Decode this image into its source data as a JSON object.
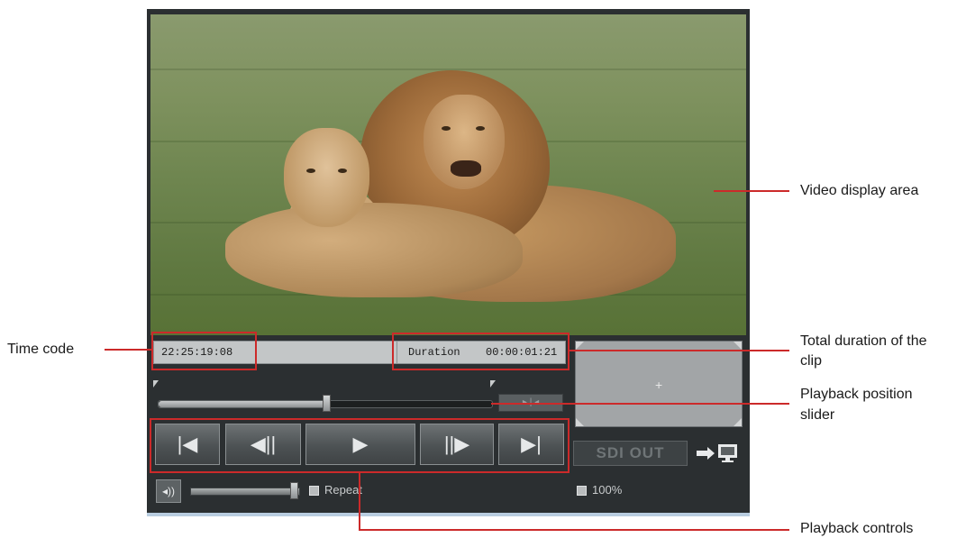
{
  "video": {
    "description_icon": "lion-pair-video-frame"
  },
  "display": {
    "timecode": "22:25:19:08",
    "duration_label": "Duration",
    "duration_value": "00:00:01:21",
    "preview_plus": "+"
  },
  "slider": {
    "position_fraction": 0.51
  },
  "controls": [
    {
      "name": "skip-to-start",
      "glyph": "|◀"
    },
    {
      "name": "previous-frame",
      "glyph": "◀||"
    },
    {
      "name": "play",
      "glyph": "▶"
    },
    {
      "name": "next-frame",
      "glyph": "||▶"
    },
    {
      "name": "skip-to-end",
      "glyph": "▶|"
    }
  ],
  "sdi_out": {
    "label": "SDI OUT",
    "icon": "arrow-to-monitor-icon"
  },
  "volume": {
    "icon": "speaker-icon",
    "level_fraction": 0.95
  },
  "repeat": {
    "label": "Repeat"
  },
  "zoom": {
    "label": "100%"
  },
  "annotations": {
    "time_code": "Time code",
    "video_display_area": "Video display area",
    "total_duration_line1": "Total duration of the",
    "total_duration_line2": "clip",
    "slider_line1": "Playback position",
    "slider_line2": "slider",
    "playback_controls": "Playback controls"
  },
  "colors": {
    "annotation_red": "#cc2a2a",
    "player_bg": "#2b2f31"
  }
}
